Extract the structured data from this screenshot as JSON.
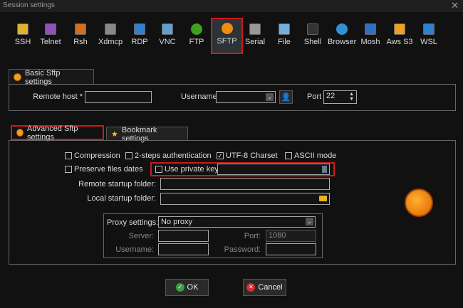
{
  "window": {
    "title": "Session settings",
    "close": "✕"
  },
  "protocols": [
    {
      "label": "SSH",
      "color": "#e0b030"
    },
    {
      "label": "Telnet",
      "color": "#9050c0"
    },
    {
      "label": "Rsh",
      "color": "#d07020"
    },
    {
      "label": "Xdmcp",
      "color": "#888888"
    },
    {
      "label": "RDP",
      "color": "#3080d0"
    },
    {
      "label": "VNC",
      "color": "#60a0d0"
    },
    {
      "label": "FTP",
      "color": "#40a020"
    },
    {
      "label": "SFTP",
      "color": "#f08a10",
      "selected": true
    },
    {
      "label": "Serial",
      "color": "#999999"
    },
    {
      "label": "File",
      "color": "#70b0e0"
    },
    {
      "label": "Shell",
      "color": "#333333"
    },
    {
      "label": "Browser",
      "color": "#3090d0"
    },
    {
      "label": "Mosh",
      "color": "#3070c0"
    },
    {
      "label": "Aws S3",
      "color": "#f0a020"
    },
    {
      "label": "WSL",
      "color": "#3080d0"
    }
  ],
  "basic": {
    "tab": "Basic Sftp settings",
    "remote_host_label": "Remote host *",
    "remote_host": "",
    "username_label": "Username",
    "username": "",
    "port_label": "Port",
    "port": "22"
  },
  "advanced": {
    "tab": "Advanced Sftp settings",
    "bookmark_tab": "Bookmark settings",
    "compression": "Compression",
    "two_steps": "2-steps authentication",
    "utf8": "UTF-8 Charset",
    "ascii": "ASCII mode",
    "preserve": "Preserve files dates",
    "private_key": "Use private key",
    "private_key_value": "",
    "remote_folder_label": "Remote startup folder:",
    "remote_folder": "",
    "local_folder_label": "Local startup folder:",
    "local_folder": "",
    "proxy_label": "Proxy settings:",
    "proxy": "No proxy",
    "server_label": "Server:",
    "server": "",
    "proxy_port_label": "Port:",
    "proxy_port": "1080",
    "proxy_user_label": "Username:",
    "proxy_user": "",
    "proxy_pass_label": "Password:",
    "proxy_pass": ""
  },
  "buttons": {
    "ok": "OK",
    "cancel": "Cancel"
  },
  "colors": {
    "accent": "#d01818",
    "background": "#111111"
  }
}
